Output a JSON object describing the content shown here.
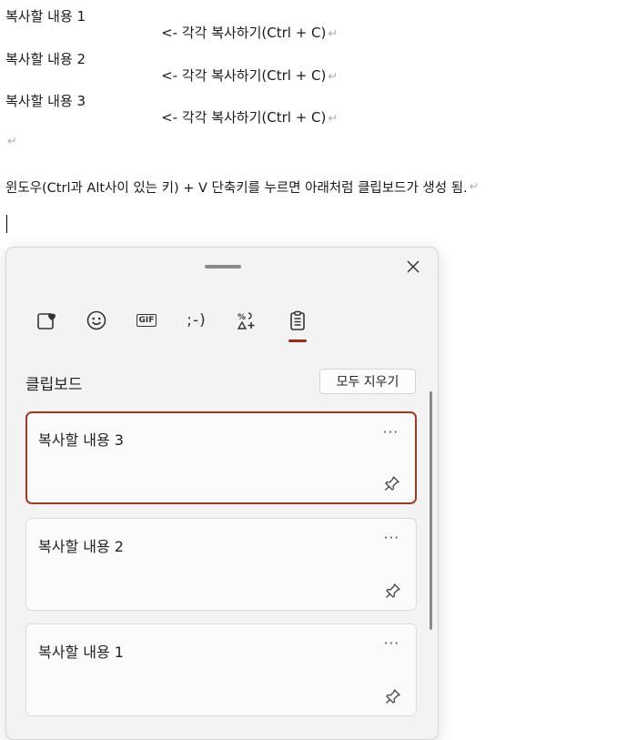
{
  "document": {
    "lines": [
      {
        "text": "복사할 내용 1",
        "hint": "<- 각각 복사하기(Ctrl + C)"
      },
      {
        "text": "복사할 내용 2",
        "hint": "<- 각각 복사하기(Ctrl + C)"
      },
      {
        "text": "복사할 내용 3",
        "hint": "<- 각각 복사하기(Ctrl + C)"
      }
    ],
    "instruction": "윈도우(Ctrl과 Alt사이 있는 키) + V 단축키를 누르면 아래처럼 클립보드가 생성 됨.",
    "paragraph_mark": "↵"
  },
  "panel": {
    "tabs": [
      {
        "name": "favorites-icon"
      },
      {
        "name": "emoji-icon"
      },
      {
        "name": "gif-icon",
        "label": "GIF"
      },
      {
        "name": "kaomoji-icon",
        "label": ";-)"
      },
      {
        "name": "symbols-icon"
      },
      {
        "name": "clipboard-icon",
        "active": true
      }
    ],
    "section_title": "클립보드",
    "clear_all_label": "모두 지우기",
    "items": [
      {
        "text": "복사할 내용 3",
        "selected": true
      },
      {
        "text": "복사할 내용 2",
        "selected": false
      },
      {
        "text": "복사할 내용 1",
        "selected": false
      }
    ],
    "more_label": "···",
    "accent_color": "#9e2a12"
  }
}
